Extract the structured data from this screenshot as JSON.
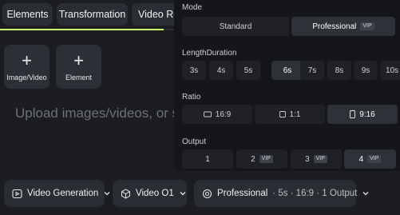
{
  "tabs": [
    {
      "label": "Elements"
    },
    {
      "label": "Transformation"
    },
    {
      "label": "Video Re"
    }
  ],
  "tiles": [
    {
      "label": "Image/Video"
    },
    {
      "label": "Element"
    }
  ],
  "upload_placeholder": "Upload images/videos, or s",
  "bottom": {
    "generation_mode": "Video Generation",
    "model": "Video O1",
    "mode": "Professional",
    "summary": "· 5s · 16:9 · 1 Output"
  },
  "panel": {
    "mode": {
      "label": "Mode",
      "options": [
        "Standard",
        "Professional"
      ],
      "selected": "Professional",
      "vip_badge": "VIP"
    },
    "duration": {
      "label": "LengthDuration",
      "options": [
        "3s",
        "4s",
        "5s",
        "6s",
        "7s",
        "8s",
        "9s",
        "10s"
      ],
      "selected": "6s"
    },
    "ratio": {
      "label": "Ratio",
      "options": [
        "16:9",
        "1:1",
        "9:16"
      ],
      "selected": "9:16"
    },
    "output": {
      "label": "Output",
      "options": [
        "1",
        "2",
        "3",
        "4"
      ],
      "selected": "4",
      "vip_badge": "VIP"
    }
  },
  "colors": {
    "accent": "#c6f36b",
    "background": "#1b1d21",
    "panel": "#151619"
  }
}
